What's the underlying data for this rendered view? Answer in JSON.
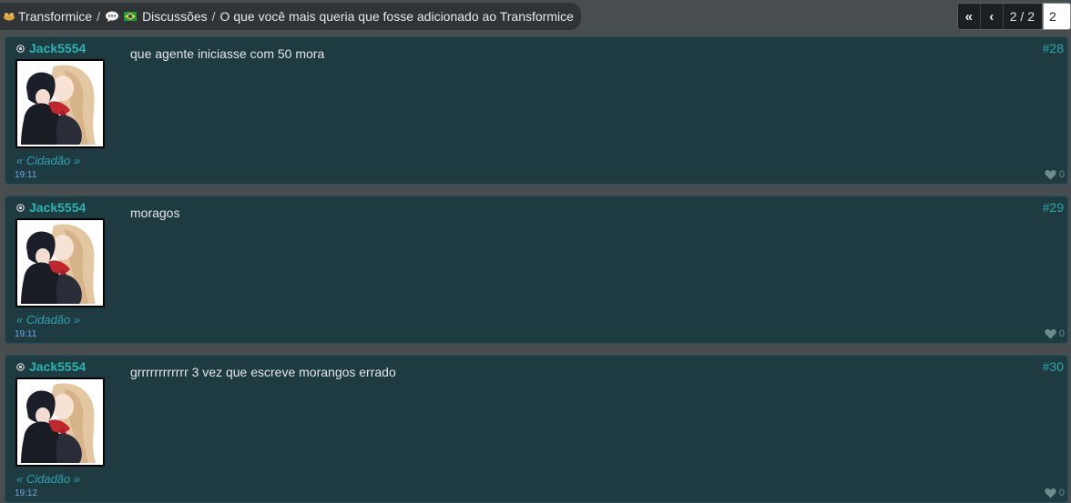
{
  "breadcrumb": {
    "section": "Transformice",
    "separator": "/",
    "forum": "Discussões",
    "thread": "O que você mais queria que fosse adicionado ao Transformice"
  },
  "pagination": {
    "first_label": "«",
    "prev_label": "‹",
    "info": "2 / 2",
    "page_input": "2"
  },
  "posts": [
    {
      "author": "Jack5554",
      "rank": "« Cidadão »",
      "time": "19:11",
      "content": "que agente iniciasse com 50 mora",
      "number": "#28",
      "likes": "0"
    },
    {
      "author": "Jack5554",
      "rank": "« Cidadão »",
      "time": "19:11",
      "content": "moragos",
      "number": "#29",
      "likes": "0"
    },
    {
      "author": "Jack5554",
      "rank": "« Cidadão »",
      "time": "19:12",
      "content": "grrrrrrrrrrrr 3 vez que escreve morangos errado",
      "number": "#30",
      "likes": "0"
    }
  ],
  "colors": {
    "page_bg": "#484d50",
    "post_bg": "#1e3b42",
    "author": "#2bb3b0",
    "rank": "#2fa3b0",
    "time": "#6aa7e8",
    "post_number": "#2aa8aa"
  },
  "icons": [
    "mouse-icon",
    "speech-bubble-icon",
    "brazil-flag-icon",
    "status-icon",
    "heart-icon"
  ]
}
